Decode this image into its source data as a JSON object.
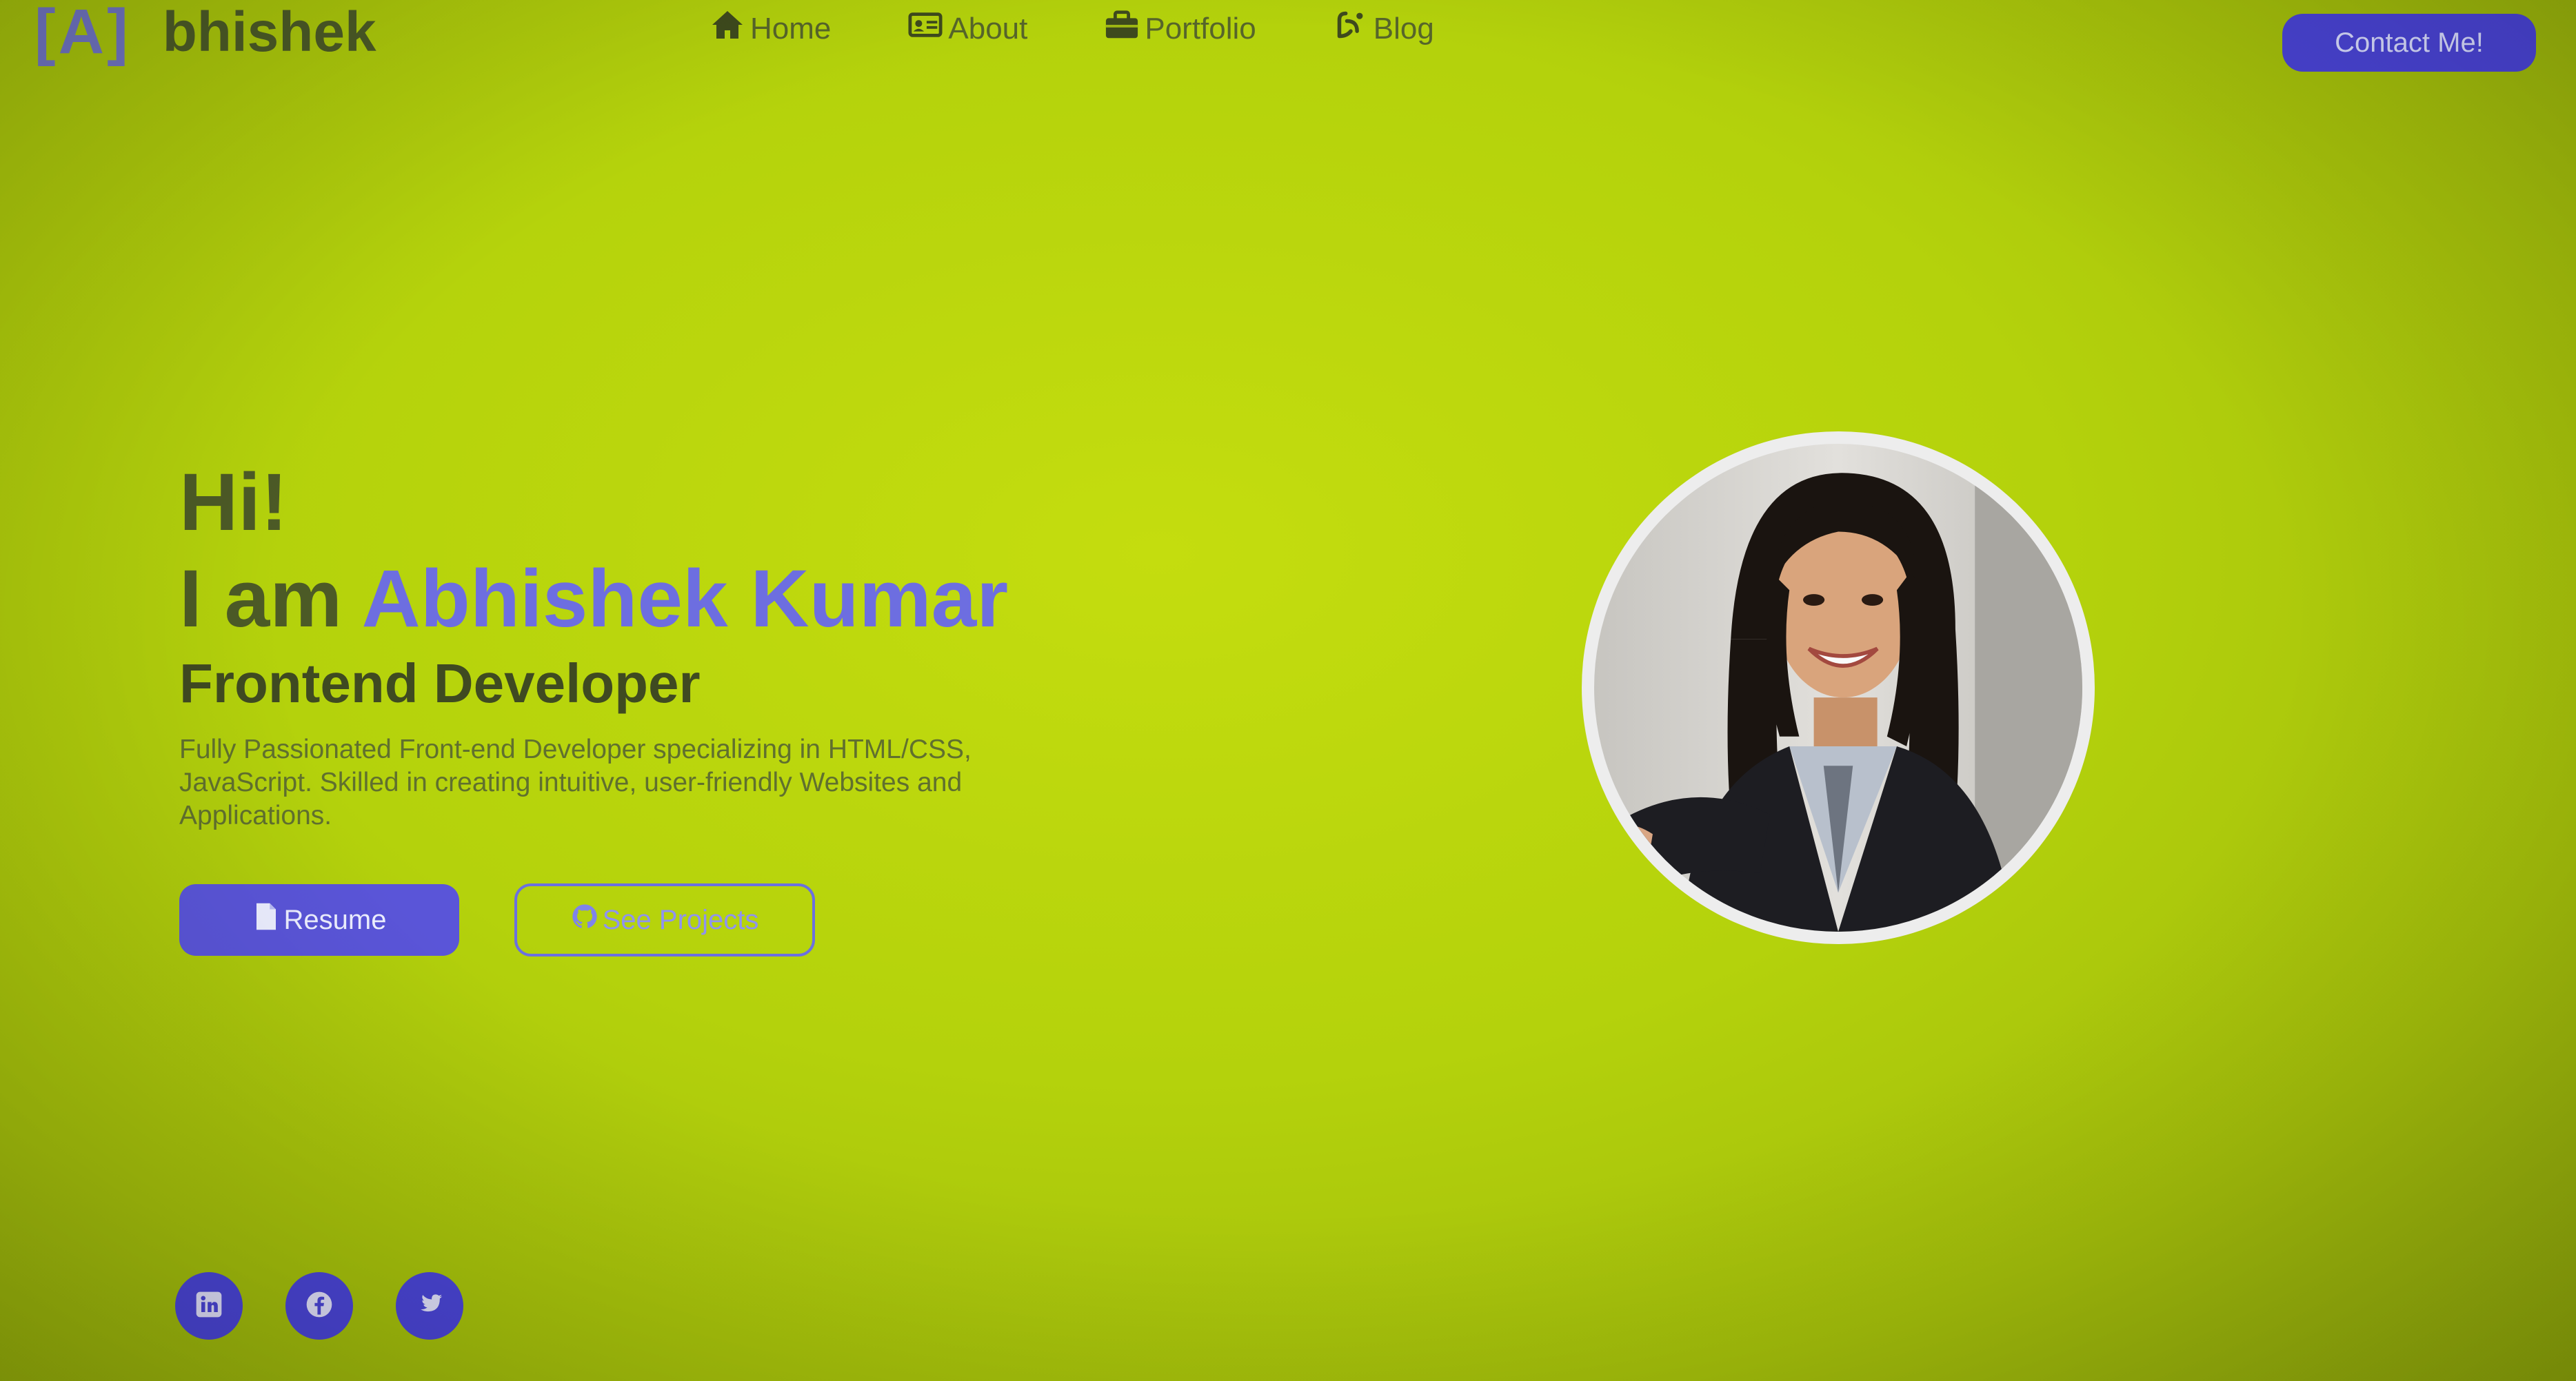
{
  "header": {
    "logo_mark": "[A]",
    "logo_text": "bhishek",
    "nav": [
      {
        "label": "Home",
        "icon": "home-icon"
      },
      {
        "label": "About",
        "icon": "id-card-icon"
      },
      {
        "label": "Portfolio",
        "icon": "briefcase-icon"
      },
      {
        "label": "Blog",
        "icon": "blog-icon"
      }
    ],
    "contact_label": "Contact Me!"
  },
  "hero": {
    "greeting": "Hi!",
    "intro_prefix": "I am ",
    "name": "Abhishek Kumar",
    "role": "Frontend Developer",
    "description": "Fully Passionated Front-end Developer specializing in HTML/CSS, JavaScript. Skilled in creating intuitive, user-friendly Websites and Applications.",
    "resume_label": "Resume",
    "projects_label": "See Projects"
  },
  "socials": [
    {
      "icon": "linkedin-icon"
    },
    {
      "icon": "facebook-icon"
    },
    {
      "icon": "twitter-icon"
    }
  ],
  "colors": {
    "background": "#b4d20c",
    "accent": "#4a44d6",
    "name_accent": "#6d6ee0",
    "text_dark": "#4c5a26"
  }
}
